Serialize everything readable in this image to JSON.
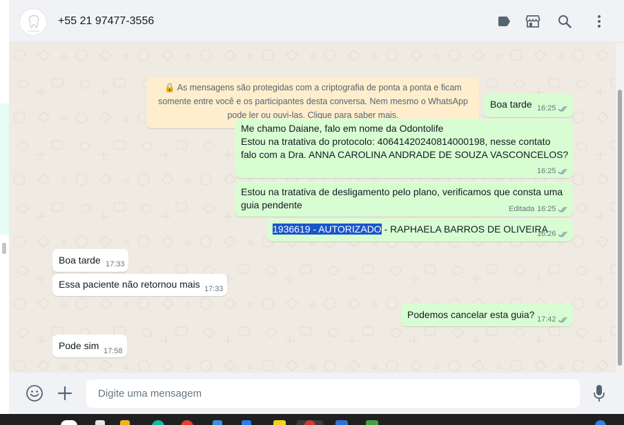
{
  "header": {
    "contact_name": "+55 21 97477-3556"
  },
  "e2e_notice": {
    "lines": [
      "🔒 As mensagens são protegidas com a criptografia de ponta a ponta e ficam",
      "somente entre você e os participantes desta conversa. Nem mesmo o WhatsApp",
      "pode ler ou ouvi-las. Clique para saber mais."
    ]
  },
  "messages": [
    {
      "direction": "out",
      "lines": [
        "Boa tarde"
      ],
      "time": "16:25",
      "status": "read"
    },
    {
      "direction": "out",
      "lines": [
        "Me chamo Daiane, falo em nome da Odontolife",
        "Estou na tratativa do protocolo: 40641420240814000198, nesse contato",
        "falo com a Dra. ANNA CAROLINA ANDRADE DE SOUZA VASCONCELOS?"
      ],
      "time": "16:25",
      "status": "read"
    },
    {
      "direction": "out",
      "lines": [
        "Estou na tratativa de desligamento pelo plano, verificamos que consta uma",
        "guia pendente"
      ],
      "edited_label": "Editada",
      "time": "16:25",
      "status": "read"
    },
    {
      "direction": "out",
      "highlight": "1936619 - AUTORIZADO",
      "rest": " - RAPHAELA BARROS DE OLIVEIRA",
      "time": "16:26",
      "status": "read"
    },
    {
      "direction": "in",
      "lines": [
        "Boa tarde"
      ],
      "time": "17:33"
    },
    {
      "direction": "in",
      "lines": [
        "Essa paciente não retornou mais"
      ],
      "time": "17:33"
    },
    {
      "direction": "out",
      "lines": [
        "Podemos cancelar esta guia?"
      ],
      "time": "17:42",
      "status": "read"
    },
    {
      "direction": "in",
      "lines": [
        "Pode sim"
      ],
      "time": "17:58"
    }
  ],
  "composer": {
    "placeholder": "Digite uma mensagem"
  },
  "colors": {
    "outgoing_bubble": "#d9fdd3",
    "incoming_bubble": "#ffffff",
    "notice_bg": "#ffeecd",
    "chat_bg": "#efeae2",
    "read_ticks": "#8696a0",
    "selection": "#1a55c9"
  },
  "icons": {
    "header": [
      "label-icon",
      "store-icon",
      "search-icon",
      "menu-dots-icon"
    ],
    "footer": [
      "emoji-icon",
      "attach-plus-icon",
      "microphone-icon"
    ]
  }
}
